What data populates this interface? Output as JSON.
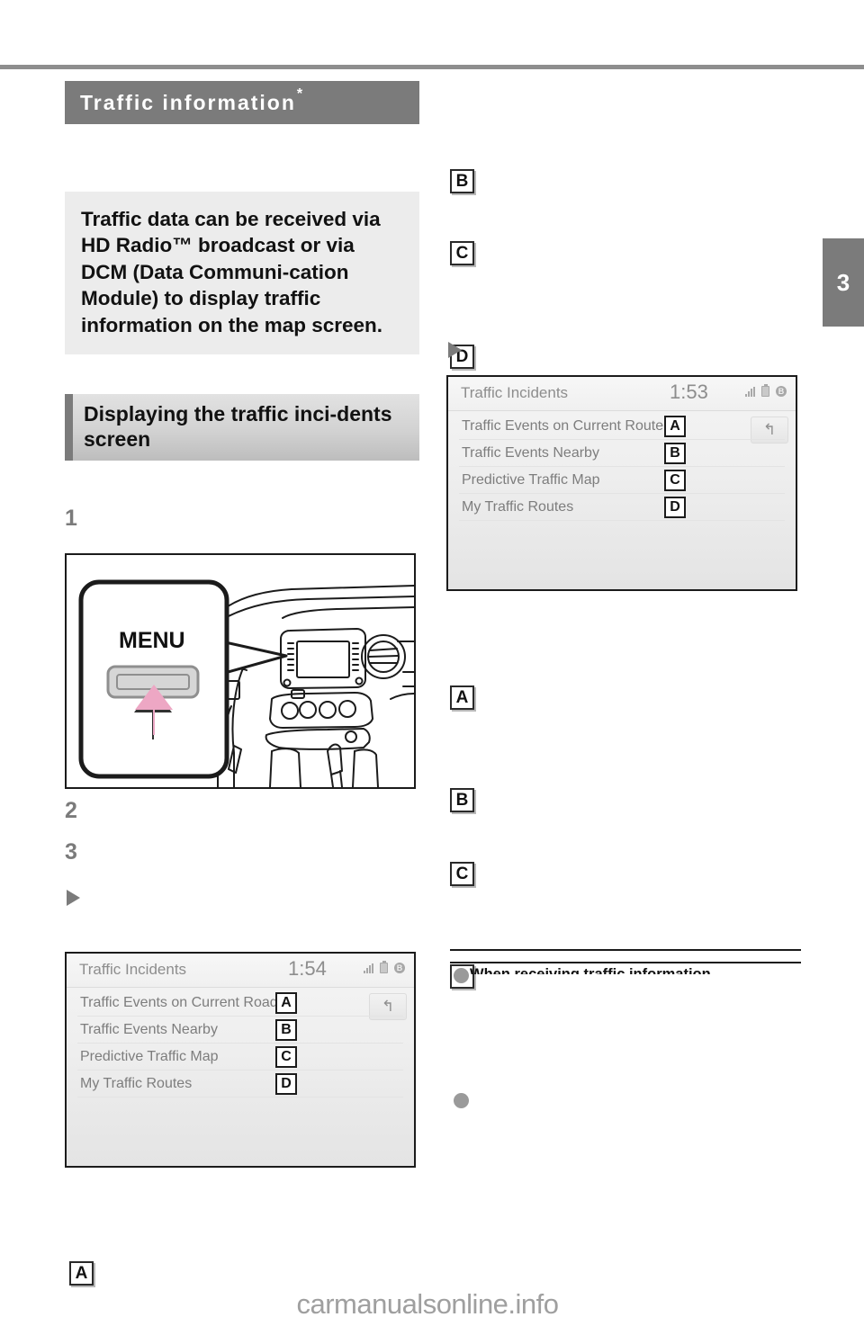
{
  "page": {
    "chapter_number": "3",
    "watermark": "carmanualsonline.info"
  },
  "section": {
    "title": "Traffic information",
    "title_footnote_mark": "*"
  },
  "intro_box": {
    "text": "Traffic data can be received via HD Radio™ broadcast or via DCM (Data Communi-cation Module) to display traffic information on the map screen."
  },
  "subsection": {
    "heading": "Displaying the traffic inci-dents screen"
  },
  "steps": {
    "step1": "1",
    "step2": "2",
    "step3": "3"
  },
  "illustration": {
    "button_label": "MENU",
    "name": "dashboard-menu-button"
  },
  "callouts": {
    "a": "A",
    "b": "B",
    "c": "C",
    "d": "D"
  },
  "screen_left": {
    "title": "Traffic Incidents",
    "clock": "1:54",
    "back_icon": "↰",
    "rows": [
      {
        "label": "Traffic Events on Current Road",
        "mark": "A"
      },
      {
        "label": "Traffic Events Nearby",
        "mark": "B"
      },
      {
        "label": "Predictive Traffic Map",
        "mark": "C"
      },
      {
        "label": "My Traffic Routes",
        "mark": "D"
      }
    ],
    "status_icons": [
      "signal-icon",
      "battery-icon",
      "bluetooth-icon"
    ]
  },
  "screen_right": {
    "title": "Traffic Incidents",
    "clock": "1:53",
    "back_icon": "↰",
    "rows": [
      {
        "label": "Traffic Events on Current Route",
        "mark": "A"
      },
      {
        "label": "Traffic Events Nearby",
        "mark": "B"
      },
      {
        "label": "Predictive Traffic Map",
        "mark": "C"
      },
      {
        "label": "My Traffic Routes",
        "mark": "D"
      }
    ],
    "status_icons": [
      "signal-icon",
      "battery-icon",
      "bluetooth-icon"
    ]
  },
  "notice": {
    "heading": "When receiving traffic information"
  },
  "colors": {
    "section_title_bg": "#7b7b7b",
    "intro_box_bg": "#ececec",
    "subhead_bar": "#7b7b7b",
    "step_number": "#7b7b7b",
    "arrow_pink": "#eda7c4",
    "screen_text": "#7d7d7d"
  }
}
